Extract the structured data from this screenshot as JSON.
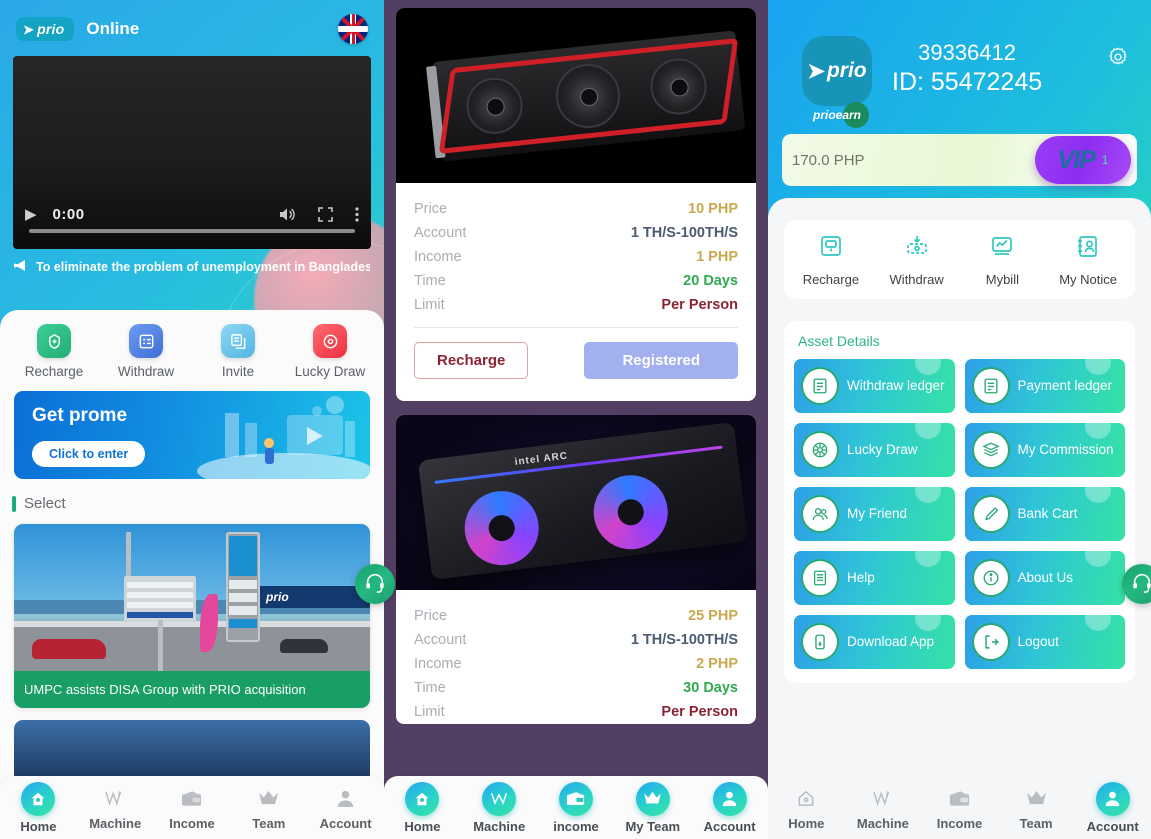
{
  "home": {
    "brand": "prio",
    "brand_mark": "➤",
    "status": "Online",
    "language_flag": "uk-flag",
    "video": {
      "time": "0:00"
    },
    "notice": "To eliminate the problem of unemployment in Banglades",
    "quick_actions": [
      {
        "label": "Recharge",
        "icon": "recharge-icon",
        "color": "#2bbd7e"
      },
      {
        "label": "Withdraw",
        "icon": "withdraw-icon",
        "color": "#4d82e8"
      },
      {
        "label": "Invite",
        "icon": "invite-icon",
        "color": "#68c7ea"
      },
      {
        "label": "Lucky Draw",
        "icon": "lucky-draw-icon",
        "color": "#f0454f"
      }
    ],
    "promo": {
      "title": "Get prome",
      "button": "Click to enter"
    },
    "section_title": "Select",
    "news": {
      "caption": "UMPC assists DISA Group with PRIO acquisition"
    },
    "tabs": [
      {
        "label": "Home",
        "icon": "home-icon",
        "active": true
      },
      {
        "label": "Machine",
        "icon": "machine-icon",
        "active": false
      },
      {
        "label": "Income",
        "icon": "income-icon",
        "active": false
      },
      {
        "label": "Team",
        "icon": "team-icon",
        "active": false
      },
      {
        "label": "Account",
        "icon": "account-icon",
        "active": false
      }
    ]
  },
  "machine": {
    "cards": [
      {
        "image": "gpu-red-graphics-card",
        "rows": [
          {
            "label": "Price",
            "value": "10 PHP"
          },
          {
            "label": "Account",
            "value": "1 TH/S-100TH/S"
          },
          {
            "label": "Income",
            "value": "1 PHP"
          },
          {
            "label": "Time",
            "value": "20 Days"
          },
          {
            "label": "Limit",
            "value": "Per Person"
          }
        ],
        "recharge_label": "Recharge",
        "registered_label": "Registered"
      },
      {
        "image": "gpu-intel-arc-graphics-card",
        "rows": [
          {
            "label": "Price",
            "value": "25 PHP"
          },
          {
            "label": "Account",
            "value": "1 TH/S-100TH/S"
          },
          {
            "label": "Income",
            "value": "2 PHP"
          },
          {
            "label": "Time",
            "value": "30 Days"
          },
          {
            "label": "Limit",
            "value": "Per Person"
          }
        ]
      }
    ],
    "tabs": [
      {
        "label": "Home",
        "icon": "home-icon"
      },
      {
        "label": "Machine",
        "icon": "machine-icon"
      },
      {
        "label": "income",
        "icon": "income-icon"
      },
      {
        "label": "My Team",
        "icon": "team-icon"
      },
      {
        "label": "Account",
        "icon": "account-icon"
      }
    ]
  },
  "account": {
    "brand": "prio",
    "brand_sub": "prioearn",
    "phone": "39336412",
    "id_label": "ID: 55472245",
    "settings_icon": "gear-icon",
    "balance": "170.0 PHP",
    "vip": {
      "text": "VIP",
      "level": "1"
    },
    "actions": [
      {
        "label": "Recharge",
        "icon": "recharge-monitor-icon"
      },
      {
        "label": "Withdraw",
        "icon": "withdraw-money-icon"
      },
      {
        "label": "Mybill",
        "icon": "bill-chart-icon"
      },
      {
        "label": "My Notice",
        "icon": "notice-person-icon"
      }
    ],
    "asset_title": "Asset Details",
    "tiles": [
      {
        "label": "Withdraw ledger",
        "icon": "ledger-icon"
      },
      {
        "label": "Payment ledger",
        "icon": "ledger-icon"
      },
      {
        "label": "Lucky Draw",
        "icon": "wheel-icon"
      },
      {
        "label": "My Commission",
        "icon": "stack-icon"
      },
      {
        "label": "My Friend",
        "icon": "friends-icon"
      },
      {
        "label": "Bank Cart",
        "icon": "pen-icon"
      },
      {
        "label": "Help",
        "icon": "help-doc-icon"
      },
      {
        "label": "About Us",
        "icon": "info-icon"
      },
      {
        "label": "Download App",
        "icon": "phone-icon"
      },
      {
        "label": "Logout",
        "icon": "logout-icon"
      }
    ],
    "tabs": [
      {
        "label": "Home",
        "icon": "home-icon",
        "active": false
      },
      {
        "label": "Machine",
        "icon": "machine-icon",
        "active": false
      },
      {
        "label": "Income",
        "icon": "income-icon",
        "active": false
      },
      {
        "label": "Team",
        "icon": "team-icon",
        "active": false
      },
      {
        "label": "Account",
        "icon": "account-icon",
        "active": true
      }
    ]
  },
  "support_button": {
    "icon": "headset-support-icon"
  }
}
